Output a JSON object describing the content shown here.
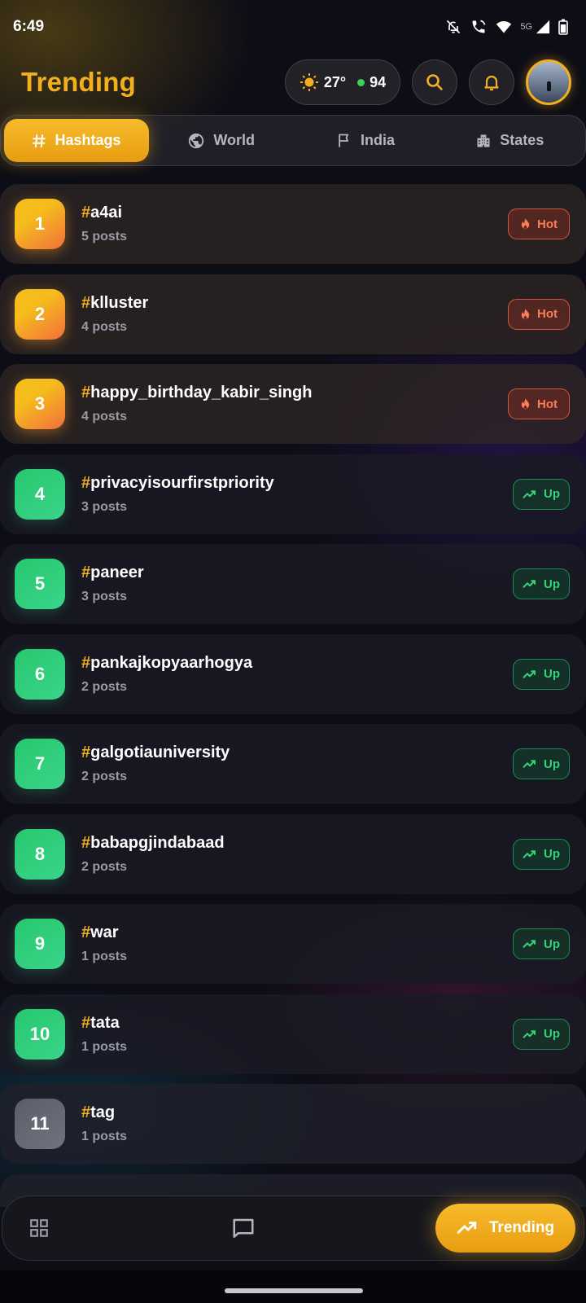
{
  "status_bar": {
    "time": "6:49",
    "network": "5G"
  },
  "header": {
    "title": "Trending",
    "weather": {
      "temperature": "27°",
      "aqi": "94",
      "aqi_color": "#3ccf5a"
    },
    "accent_color": "#f2b01e"
  },
  "tabs": [
    {
      "label": "Hashtags",
      "icon": "hash-icon",
      "active": true
    },
    {
      "label": "World",
      "icon": "globe-icon",
      "active": false
    },
    {
      "label": "India",
      "icon": "flag-icon",
      "active": false
    },
    {
      "label": "States",
      "icon": "buildings-icon",
      "active": false
    }
  ],
  "hashtags": [
    {
      "rank": "1",
      "hash": "#",
      "name": "a4ai",
      "posts": "5 posts",
      "badge": "Hot",
      "status": "hot"
    },
    {
      "rank": "2",
      "hash": "#",
      "name": "klluster",
      "posts": "4 posts",
      "badge": "Hot",
      "status": "hot"
    },
    {
      "rank": "3",
      "hash": "#",
      "name": "happy_birthday_kabir_singh",
      "posts": "4 posts",
      "badge": "Hot",
      "status": "hot"
    },
    {
      "rank": "4",
      "hash": "#",
      "name": "privacyisourfirstpriority",
      "posts": "3 posts",
      "badge": "Up",
      "status": "up"
    },
    {
      "rank": "5",
      "hash": "#",
      "name": "paneer",
      "posts": "3 posts",
      "badge": "Up",
      "status": "up"
    },
    {
      "rank": "6",
      "hash": "#",
      "name": "pankajkopyaarhogya",
      "posts": "2 posts",
      "badge": "Up",
      "status": "up"
    },
    {
      "rank": "7",
      "hash": "#",
      "name": "galgotiauniversity",
      "posts": "2 posts",
      "badge": "Up",
      "status": "up"
    },
    {
      "rank": "8",
      "hash": "#",
      "name": "babapgjindabaad",
      "posts": "2 posts",
      "badge": "Up",
      "status": "up"
    },
    {
      "rank": "9",
      "hash": "#",
      "name": "war",
      "posts": "1 posts",
      "badge": "Up",
      "status": "up"
    },
    {
      "rank": "10",
      "hash": "#",
      "name": "tata",
      "posts": "1 posts",
      "badge": "Up",
      "status": "up"
    },
    {
      "rank": "11",
      "hash": "#",
      "name": "tag",
      "posts": "1 posts",
      "badge": "",
      "status": "plain"
    }
  ],
  "bottom_nav": {
    "items": [
      {
        "icon": "grid-icon",
        "label": ""
      },
      {
        "icon": "chat-icon",
        "label": ""
      },
      {
        "icon": "trending-icon",
        "label": "Trending",
        "active": true
      }
    ]
  },
  "colors": {
    "hot": "#ff7b5a",
    "up": "#35d27a",
    "accent": "#f2b01e"
  }
}
